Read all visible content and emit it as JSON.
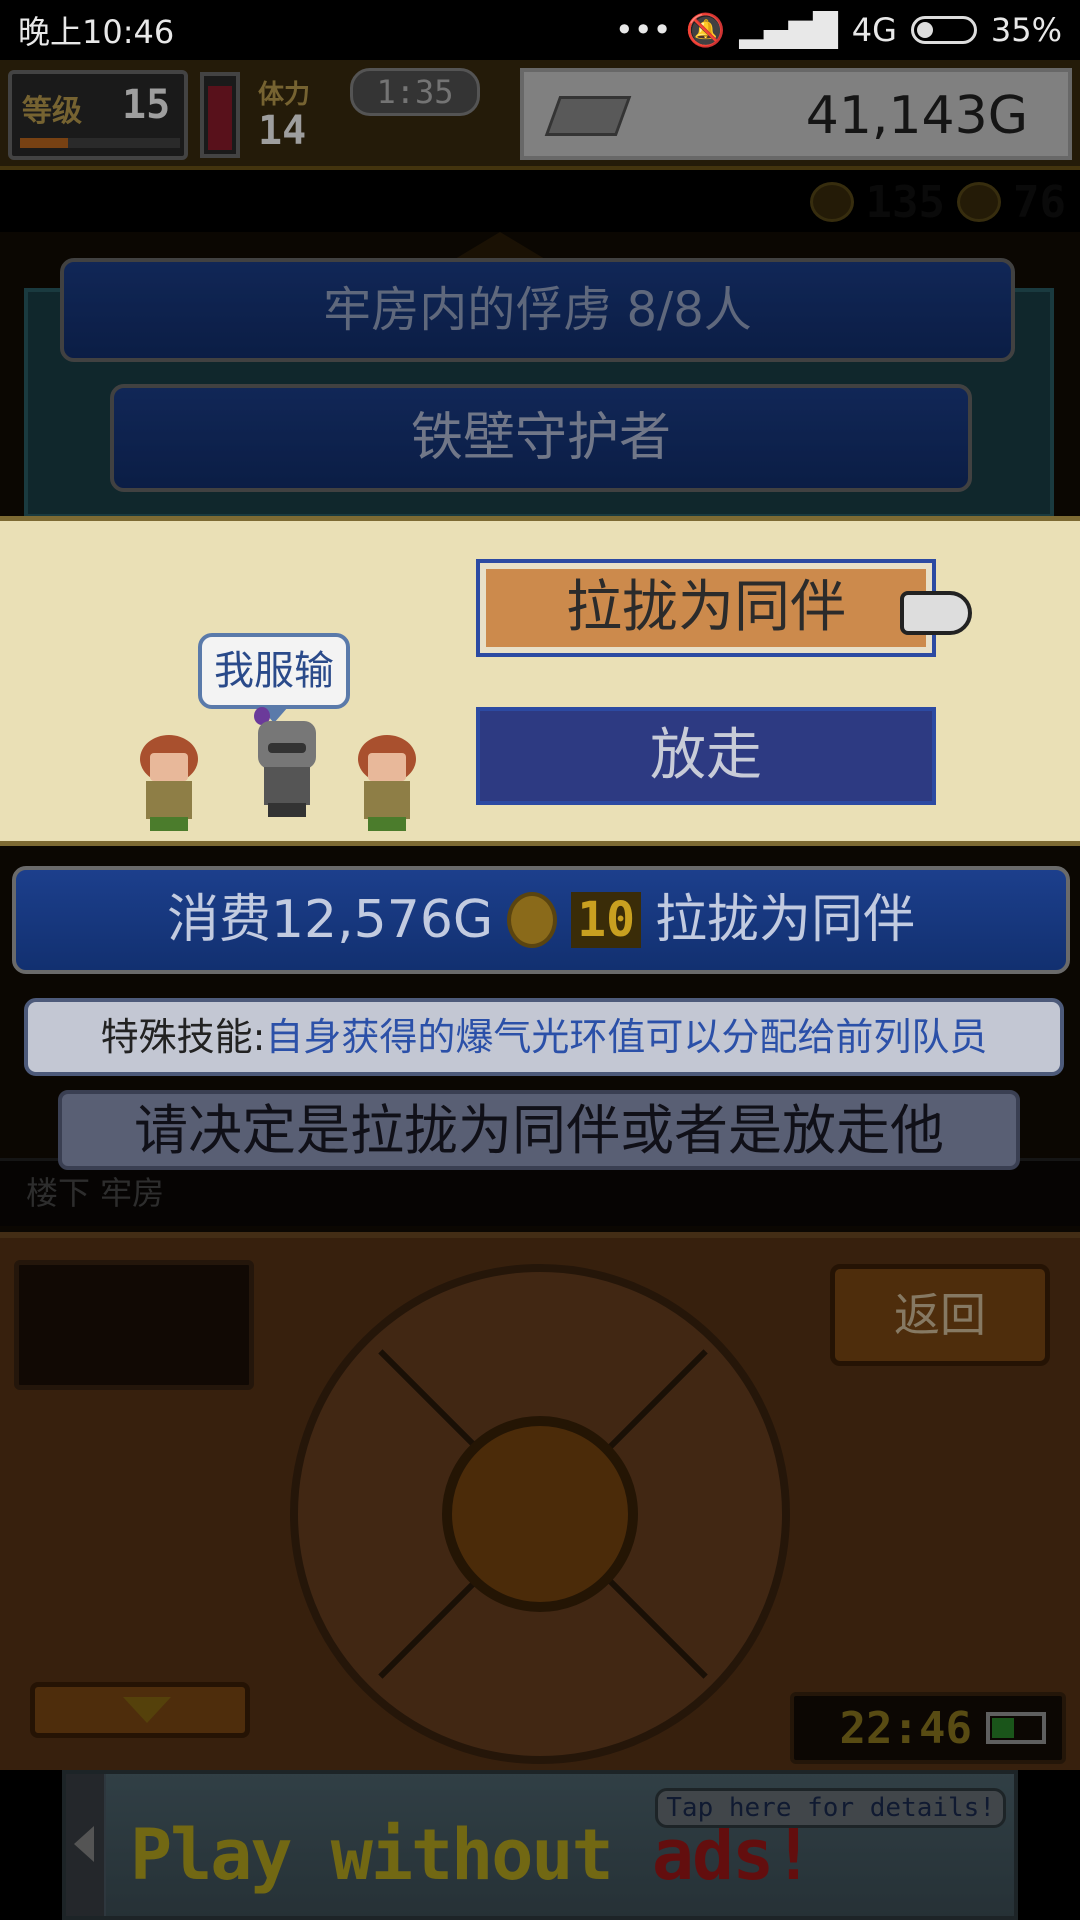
{
  "status_bar": {
    "time": "晚上10:46",
    "network": "4G",
    "battery": "35%"
  },
  "hud": {
    "level_label": "等级",
    "level_value": "15",
    "turn_label": "体力",
    "turn_value": "14",
    "timer": "1:35",
    "gold": "41,143G",
    "resource_a": "135",
    "resource_b": "76"
  },
  "dialog": {
    "prisoner_count_title": "牢房内的俘虏  8/8人",
    "prisoner_name": "铁壁守护者",
    "speech_bubble": "我服输",
    "recruit_button": "拉拢为同伴",
    "release_button": "放走",
    "cost_prefix": "消费12,576G",
    "cost_coins": "10",
    "cost_suffix": "拉拢为同伴",
    "skill_label": "特殊技能:",
    "skill_desc": "自身获得的爆气光环值可以分配给前列队员",
    "instruction": "请决定是拉拢为同伴或者是放走他",
    "location": "楼下 牢房"
  },
  "controller": {
    "back_button": "返回",
    "clock": "22:46"
  },
  "ad": {
    "text_main": "Play without",
    "text_red": "ads!",
    "tip": "Tap here for details!"
  },
  "colors": {
    "ribbon_blue": "#1c3f8c",
    "choice_bg": "#eae0b6",
    "recruit_orange": "#cc8a4c",
    "release_navy": "#2d3a82",
    "wood": "#5a3416"
  }
}
